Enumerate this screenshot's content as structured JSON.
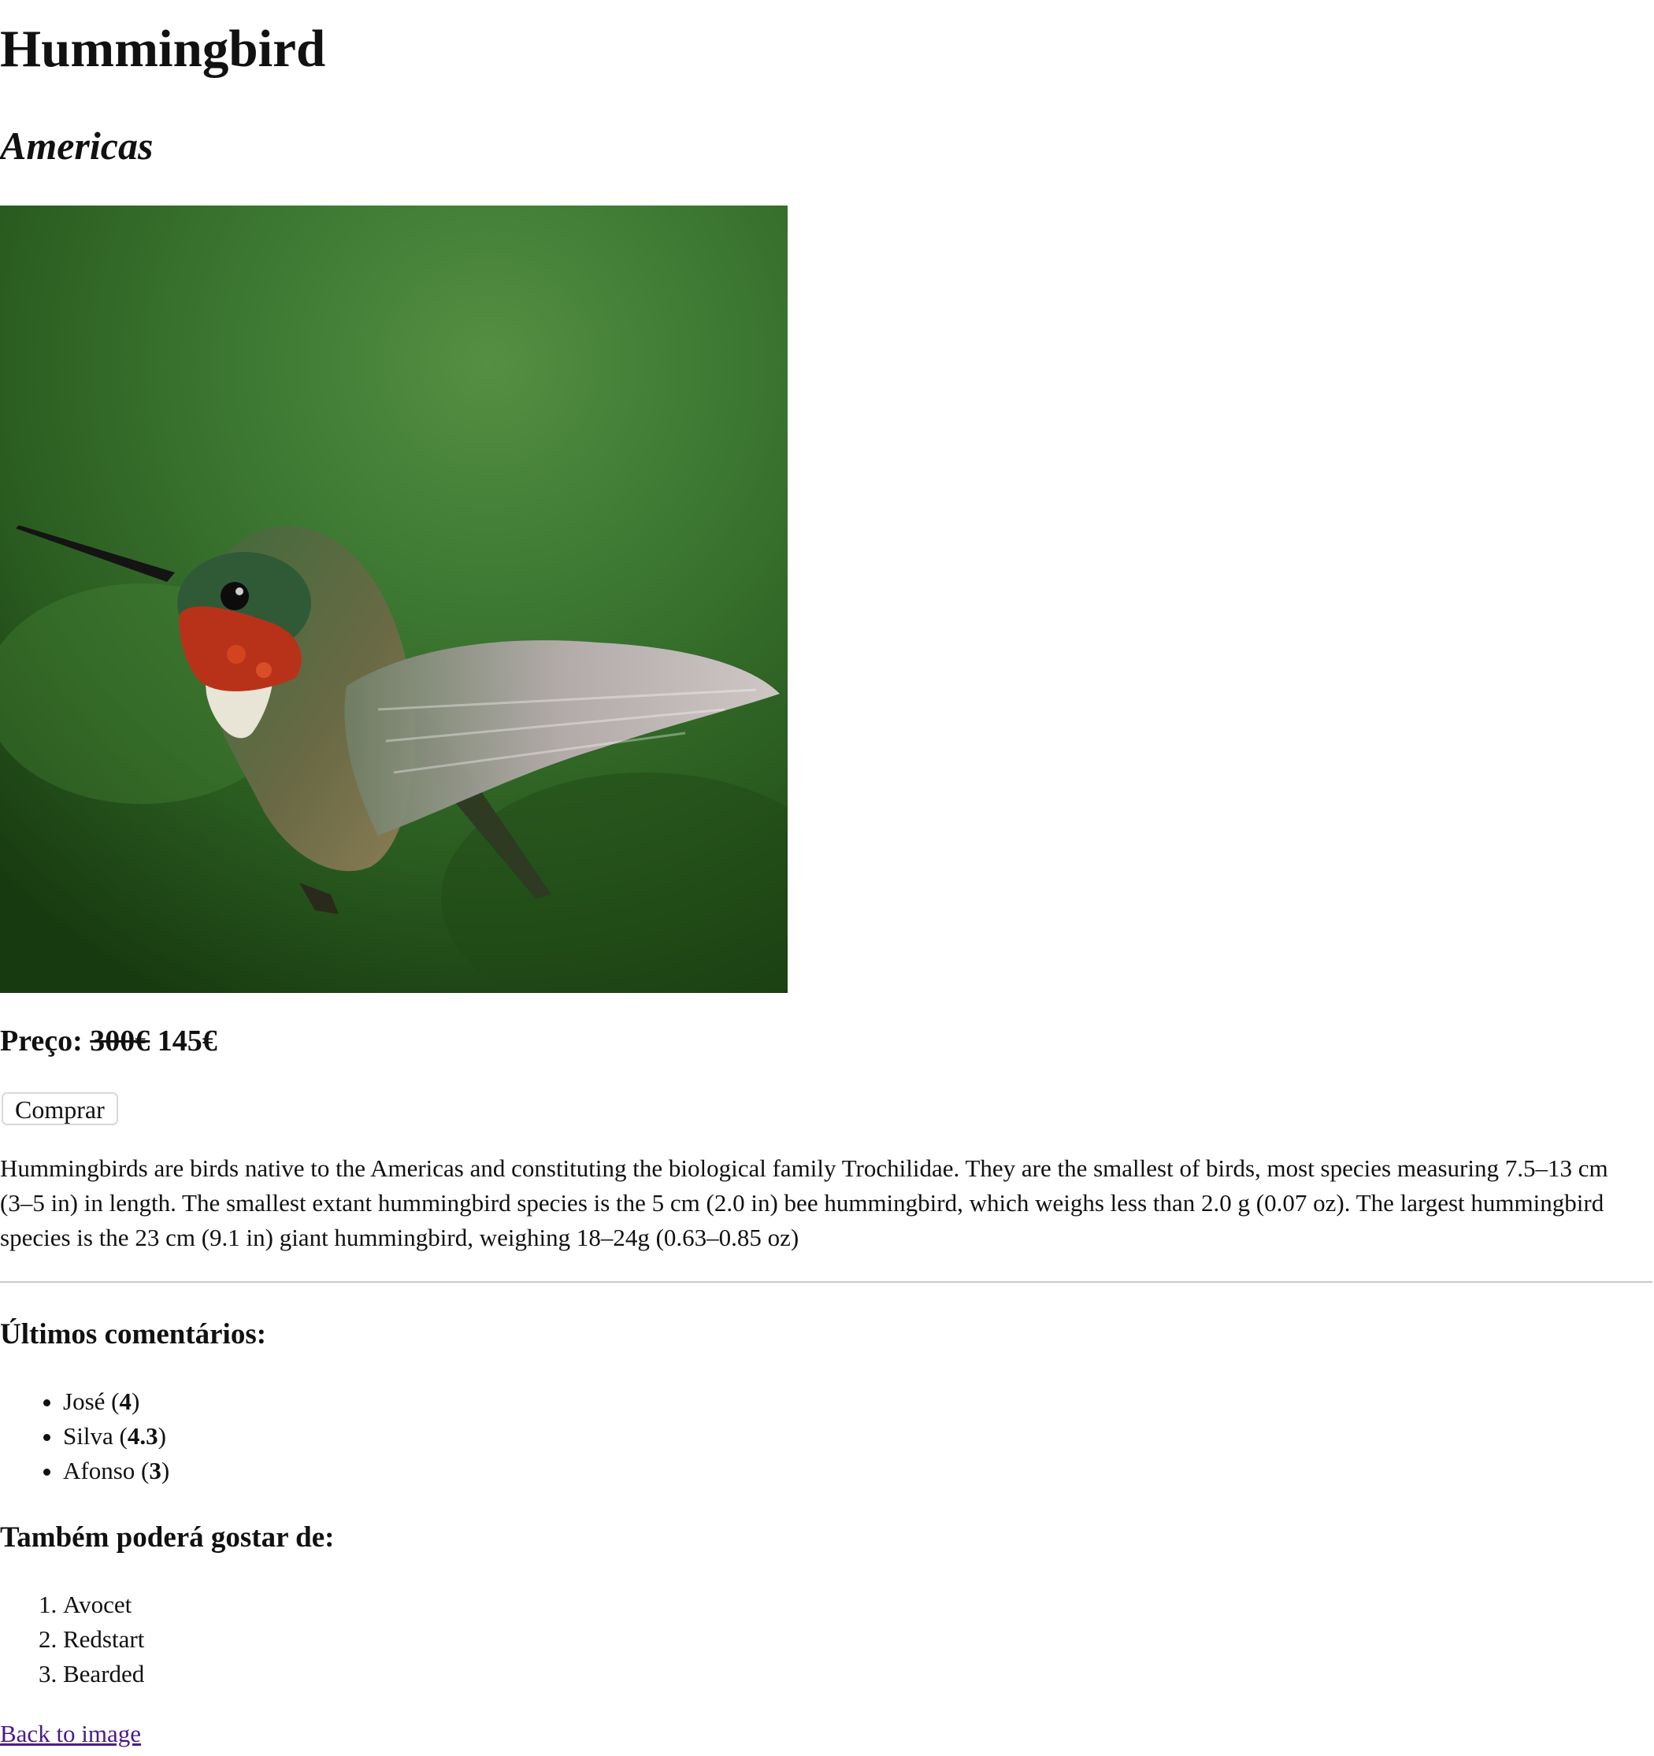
{
  "header": {
    "title": "Hummingbird",
    "subtitle": "Americas"
  },
  "image": {
    "alt": "Hummingbird in flight"
  },
  "price": {
    "label": "Preço:",
    "old": "300€",
    "current": "145€"
  },
  "buy_button": {
    "label": "Comprar"
  },
  "description": "Hummingbirds are birds native to the Americas and constituting the biological family Trochilidae. They are the smallest of birds, most species measuring 7.5–13 cm (3–5 in) in length. The smallest extant hummingbird species is the 5 cm (2.0 in) bee hummingbird, which weighs less than 2.0 g (0.07 oz). The largest hummingbird species is the 23 cm (9.1 in) giant hummingbird, weighing 18–24g (0.63–0.85 oz)",
  "comments": {
    "heading": "Últimos comentários:",
    "items": [
      {
        "name": "José",
        "rating": "4"
      },
      {
        "name": "Silva",
        "rating": "4.3"
      },
      {
        "name": "Afonso",
        "rating": "3"
      }
    ]
  },
  "suggestions": {
    "heading": "Também poderá gostar de:",
    "items": [
      "Avocet",
      "Redstart",
      "Bearded"
    ]
  },
  "back_link": {
    "label": "Back to image"
  },
  "colors": {
    "link": "#4b1b8a",
    "divider": "#c8c8c8",
    "photo_background": "#3b7530"
  }
}
